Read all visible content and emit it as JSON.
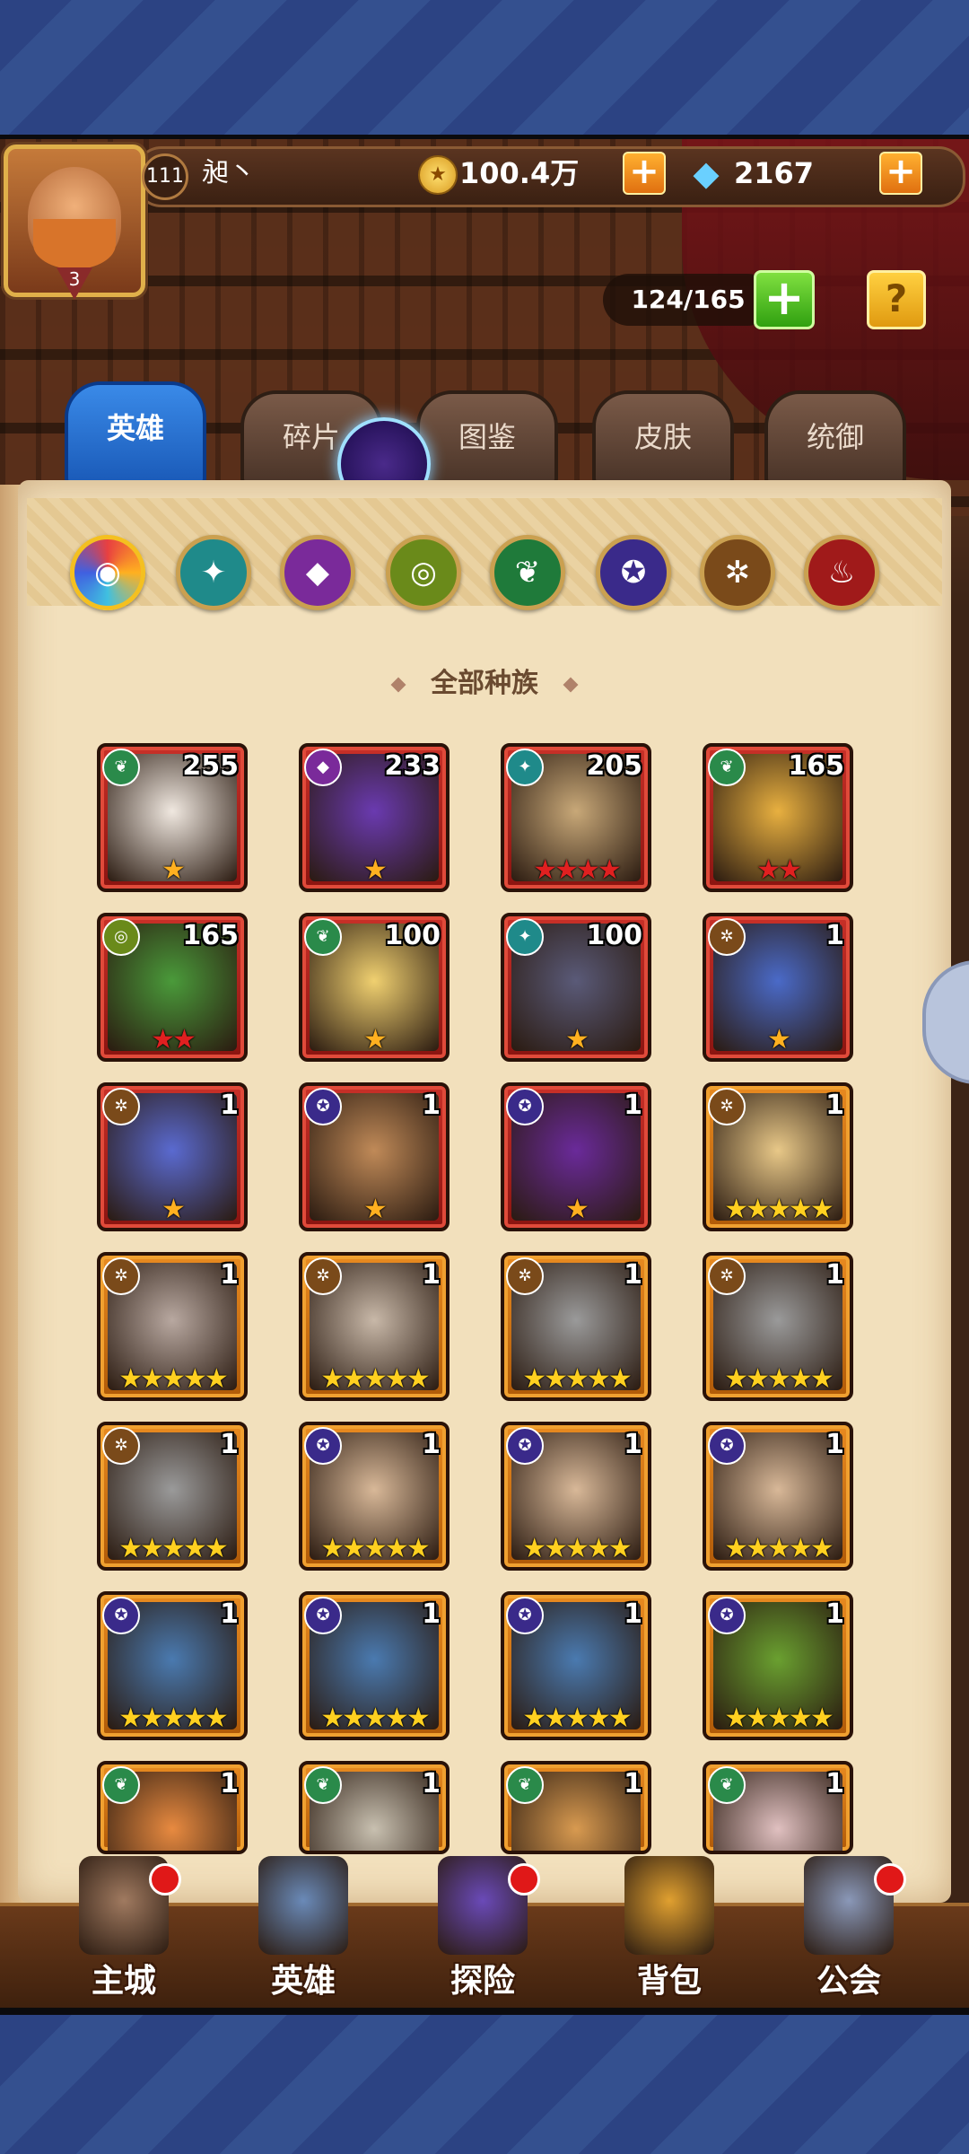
{
  "player": {
    "level": "111",
    "name": "昶丶",
    "avatar_level": "3"
  },
  "currency": {
    "gold": "100.4万",
    "diamonds": "2167"
  },
  "hero_capacity": "124/165",
  "tabs": [
    {
      "label": "英雄",
      "active": true
    },
    {
      "label": "碎片",
      "active": false
    },
    {
      "label": "图鉴",
      "active": false
    },
    {
      "label": "皮肤",
      "active": false
    },
    {
      "label": "统御",
      "active": false
    }
  ],
  "race_filters": [
    {
      "name": "all",
      "color": "#e84040",
      "icon": "◉"
    },
    {
      "name": "forest",
      "color": "#1f8a8a",
      "icon": "✦"
    },
    {
      "name": "shadow",
      "color": "#7a2a9a",
      "icon": "◆"
    },
    {
      "name": "fortress",
      "color": "#6a8a1a",
      "icon": "◎"
    },
    {
      "name": "abyss",
      "color": "#1f7a3a",
      "icon": "❦"
    },
    {
      "name": "dark",
      "color": "#3a2a8a",
      "icon": "✪"
    },
    {
      "name": "light",
      "color": "#7a4a1a",
      "icon": "✲"
    },
    {
      "name": "fire",
      "color": "#a01a1a",
      "icon": "♨"
    }
  ],
  "section_title": "全部种族",
  "heroes": [
    {
      "count": "255",
      "stars": "★",
      "frame": "red",
      "race_color": "#2a8a4a",
      "race_icon": "❦",
      "portrait": "#f0e8e0"
    },
    {
      "count": "233",
      "stars": "★",
      "frame": "red",
      "race_color": "#7a2a9a",
      "race_icon": "◆",
      "portrait": "#6a3ab0"
    },
    {
      "count": "205",
      "stars": "★★★★",
      "frame": "red",
      "race_color": "#1f8a8a",
      "race_icon": "✦",
      "portrait": "#c8a878"
    },
    {
      "count": "165",
      "stars": "★★",
      "frame": "red",
      "race_color": "#2a8a4a",
      "race_icon": "❦",
      "portrait": "#e8b040"
    },
    {
      "count": "165",
      "stars": "★★",
      "frame": "red",
      "race_color": "#6a8a1a",
      "race_icon": "◎",
      "portrait": "#4a9a3a"
    },
    {
      "count": "100",
      "stars": "★",
      "frame": "red",
      "race_color": "#2a8a4a",
      "race_icon": "❦",
      "portrait": "#f0d070"
    },
    {
      "count": "100",
      "stars": "★",
      "frame": "red",
      "race_color": "#1f8a8a",
      "race_icon": "✦",
      "portrait": "#5a5a78"
    },
    {
      "count": "1",
      "stars": "★",
      "frame": "red",
      "race_color": "#7a4a1a",
      "race_icon": "✲",
      "portrait": "#4a6ac8"
    },
    {
      "count": "1",
      "stars": "★",
      "frame": "red",
      "race_color": "#7a4a1a",
      "race_icon": "✲",
      "portrait": "#5a6ad0"
    },
    {
      "count": "1",
      "stars": "★",
      "frame": "red",
      "race_color": "#3a2a8a",
      "race_icon": "✪",
      "portrait": "#c08a58"
    },
    {
      "count": "1",
      "stars": "★",
      "frame": "red",
      "race_color": "#3a2a8a",
      "race_icon": "✪",
      "portrait": "#6a2a9a"
    },
    {
      "count": "1",
      "stars": "★★★★★",
      "frame": "orange",
      "race_color": "#7a4a1a",
      "race_icon": "✲",
      "portrait": "#e8c888"
    },
    {
      "count": "1",
      "stars": "★★★★★",
      "frame": "orange",
      "race_color": "#7a4a1a",
      "race_icon": "✲",
      "portrait": "#b8a8a0"
    },
    {
      "count": "1",
      "stars": "★★★★★",
      "frame": "orange",
      "race_color": "#7a4a1a",
      "race_icon": "✲",
      "portrait": "#c8b8a8"
    },
    {
      "count": "1",
      "stars": "★★★★★",
      "frame": "orange",
      "race_color": "#7a4a1a",
      "race_icon": "✲",
      "portrait": "#9a9a9a"
    },
    {
      "count": "1",
      "stars": "★★★★★",
      "frame": "orange",
      "race_color": "#7a4a1a",
      "race_icon": "✲",
      "portrait": "#9a9a9a"
    },
    {
      "count": "1",
      "stars": "★★★★★",
      "frame": "orange",
      "race_color": "#7a4a1a",
      "race_icon": "✲",
      "portrait": "#9a9a9a"
    },
    {
      "count": "1",
      "stars": "★★★★★",
      "frame": "orange",
      "race_color": "#3a2a8a",
      "race_icon": "✪",
      "portrait": "#d8b898"
    },
    {
      "count": "1",
      "stars": "★★★★★",
      "frame": "orange",
      "race_color": "#3a2a8a",
      "race_icon": "✪",
      "portrait": "#d8b898"
    },
    {
      "count": "1",
      "stars": "★★★★★",
      "frame": "orange",
      "race_color": "#3a2a8a",
      "race_icon": "✪",
      "portrait": "#d8b898"
    },
    {
      "count": "1",
      "stars": "★★★★★",
      "frame": "orange",
      "race_color": "#3a2a8a",
      "race_icon": "✪",
      "portrait": "#4a7ab0"
    },
    {
      "count": "1",
      "stars": "★★★★★",
      "frame": "orange",
      "race_color": "#3a2a8a",
      "race_icon": "✪",
      "portrait": "#4a7ab0"
    },
    {
      "count": "1",
      "stars": "★★★★★",
      "frame": "orange",
      "race_color": "#3a2a8a",
      "race_icon": "✪",
      "portrait": "#4a7ab0"
    },
    {
      "count": "1",
      "stars": "★★★★★",
      "frame": "orange",
      "race_color": "#3a2a8a",
      "race_icon": "✪",
      "portrait": "#6aa030"
    },
    {
      "count": "1",
      "stars": "",
      "frame": "orange",
      "race_color": "#2a8a4a",
      "race_icon": "❦",
      "portrait": "#e88a40"
    },
    {
      "count": "1",
      "stars": "",
      "frame": "orange",
      "race_color": "#2a8a4a",
      "race_icon": "❦",
      "portrait": "#c8c0b0"
    },
    {
      "count": "1",
      "stars": "",
      "frame": "orange",
      "race_color": "#2a8a4a",
      "race_icon": "❦",
      "portrait": "#d89a50"
    },
    {
      "count": "1",
      "stars": "",
      "frame": "orange",
      "race_color": "#2a8a4a",
      "race_icon": "❦",
      "portrait": "#e0c0c0"
    }
  ],
  "bottom_nav": [
    {
      "label": "主城",
      "badge": true,
      "icon_color": "#a07a60"
    },
    {
      "label": "英雄",
      "badge": false,
      "icon_color": "#6a8ab8"
    },
    {
      "label": "探险",
      "badge": true,
      "icon_color": "#6a4ab8"
    },
    {
      "label": "背包",
      "badge": false,
      "icon_color": "#e0a030"
    },
    {
      "label": "公会",
      "badge": true,
      "icon_color": "#8a98b8"
    }
  ]
}
